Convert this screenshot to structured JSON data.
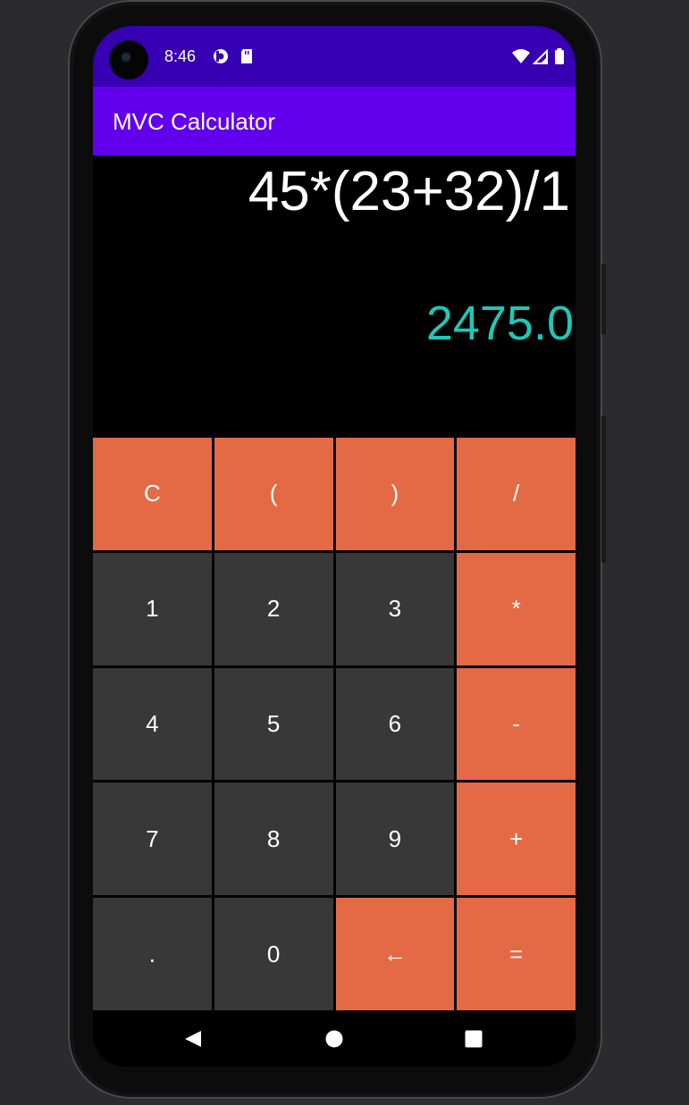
{
  "status_bar": {
    "time": "8:46",
    "icons": [
      "notification-app-icon",
      "sd-card-icon",
      "wifi-icon",
      "signal-icon",
      "battery-icon"
    ]
  },
  "app_bar": {
    "title": "MVC Calculator",
    "color": "#6200ee",
    "status_color": "#3700b3"
  },
  "display": {
    "expression": "45*(23+32)/1",
    "result": "2475.0",
    "result_color": "#1fc7b6"
  },
  "keypad": {
    "operator_color": "#e46a45",
    "number_color": "#383838",
    "keys": [
      {
        "label": "C",
        "type": "op",
        "name": "clear-button"
      },
      {
        "label": "(",
        "type": "op",
        "name": "open-paren-button"
      },
      {
        "label": ")",
        "type": "op",
        "name": "close-paren-button"
      },
      {
        "label": "/",
        "type": "op",
        "name": "divide-button"
      },
      {
        "label": "1",
        "type": "num",
        "name": "digit-1-button"
      },
      {
        "label": "2",
        "type": "num",
        "name": "digit-2-button"
      },
      {
        "label": "3",
        "type": "num",
        "name": "digit-3-button"
      },
      {
        "label": "*",
        "type": "op",
        "name": "multiply-button"
      },
      {
        "label": "4",
        "type": "num",
        "name": "digit-4-button"
      },
      {
        "label": "5",
        "type": "num",
        "name": "digit-5-button"
      },
      {
        "label": "6",
        "type": "num",
        "name": "digit-6-button"
      },
      {
        "label": "-",
        "type": "op",
        "name": "subtract-button"
      },
      {
        "label": "7",
        "type": "num",
        "name": "digit-7-button"
      },
      {
        "label": "8",
        "type": "num",
        "name": "digit-8-button"
      },
      {
        "label": "9",
        "type": "num",
        "name": "digit-9-button"
      },
      {
        "label": "+",
        "type": "op",
        "name": "add-button"
      },
      {
        "label": ".",
        "type": "num",
        "name": "decimal-button"
      },
      {
        "label": "0",
        "type": "num",
        "name": "digit-0-button"
      },
      {
        "label": "←",
        "type": "op",
        "name": "backspace-button"
      },
      {
        "label": "=",
        "type": "op",
        "name": "equals-button"
      }
    ]
  },
  "nav_bar": {
    "buttons": [
      "back-icon",
      "home-icon",
      "recents-icon"
    ]
  }
}
